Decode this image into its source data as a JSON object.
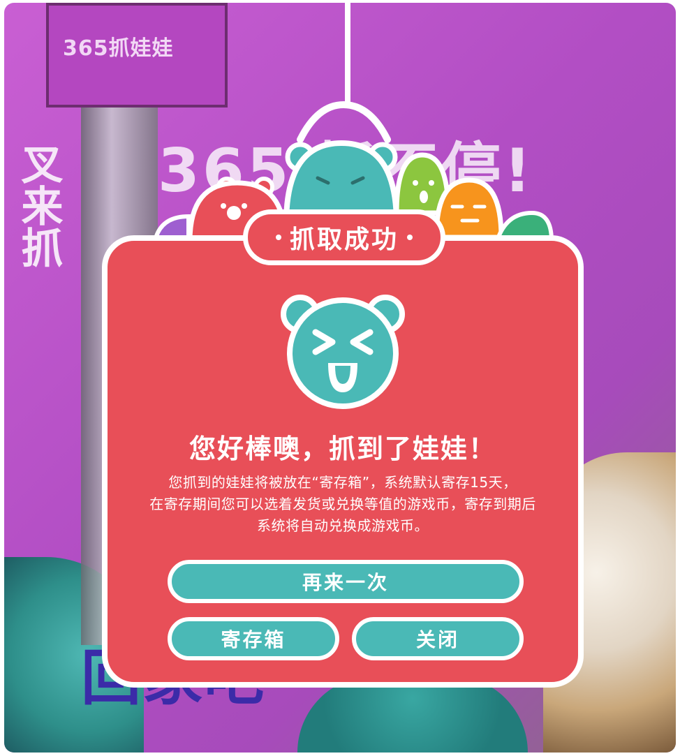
{
  "background": {
    "banner_text": "365抓娃娃",
    "slogan_text": "365 抓不停!",
    "side_text": "叉来抓",
    "bottom_text": "回家吧"
  },
  "dialog": {
    "title": "抓取成功",
    "headline": "您好棒噢，抓到了娃娃！",
    "description_lines": [
      "您抓到的娃娃将被放在“寄存箱”，系统默认寄存15天，",
      "在寄存期间您可以选着发货或兑换等值的游戏币，寄存到期后",
      "系统将自动兑换成游戏币。"
    ],
    "buttons": {
      "again": "再来一次",
      "storage_box": "寄存箱",
      "close": "关闭"
    }
  },
  "colors": {
    "dialog_red": "#e84f58",
    "button_teal": "#4ab9b6",
    "background_purple": "#c95fd3"
  }
}
